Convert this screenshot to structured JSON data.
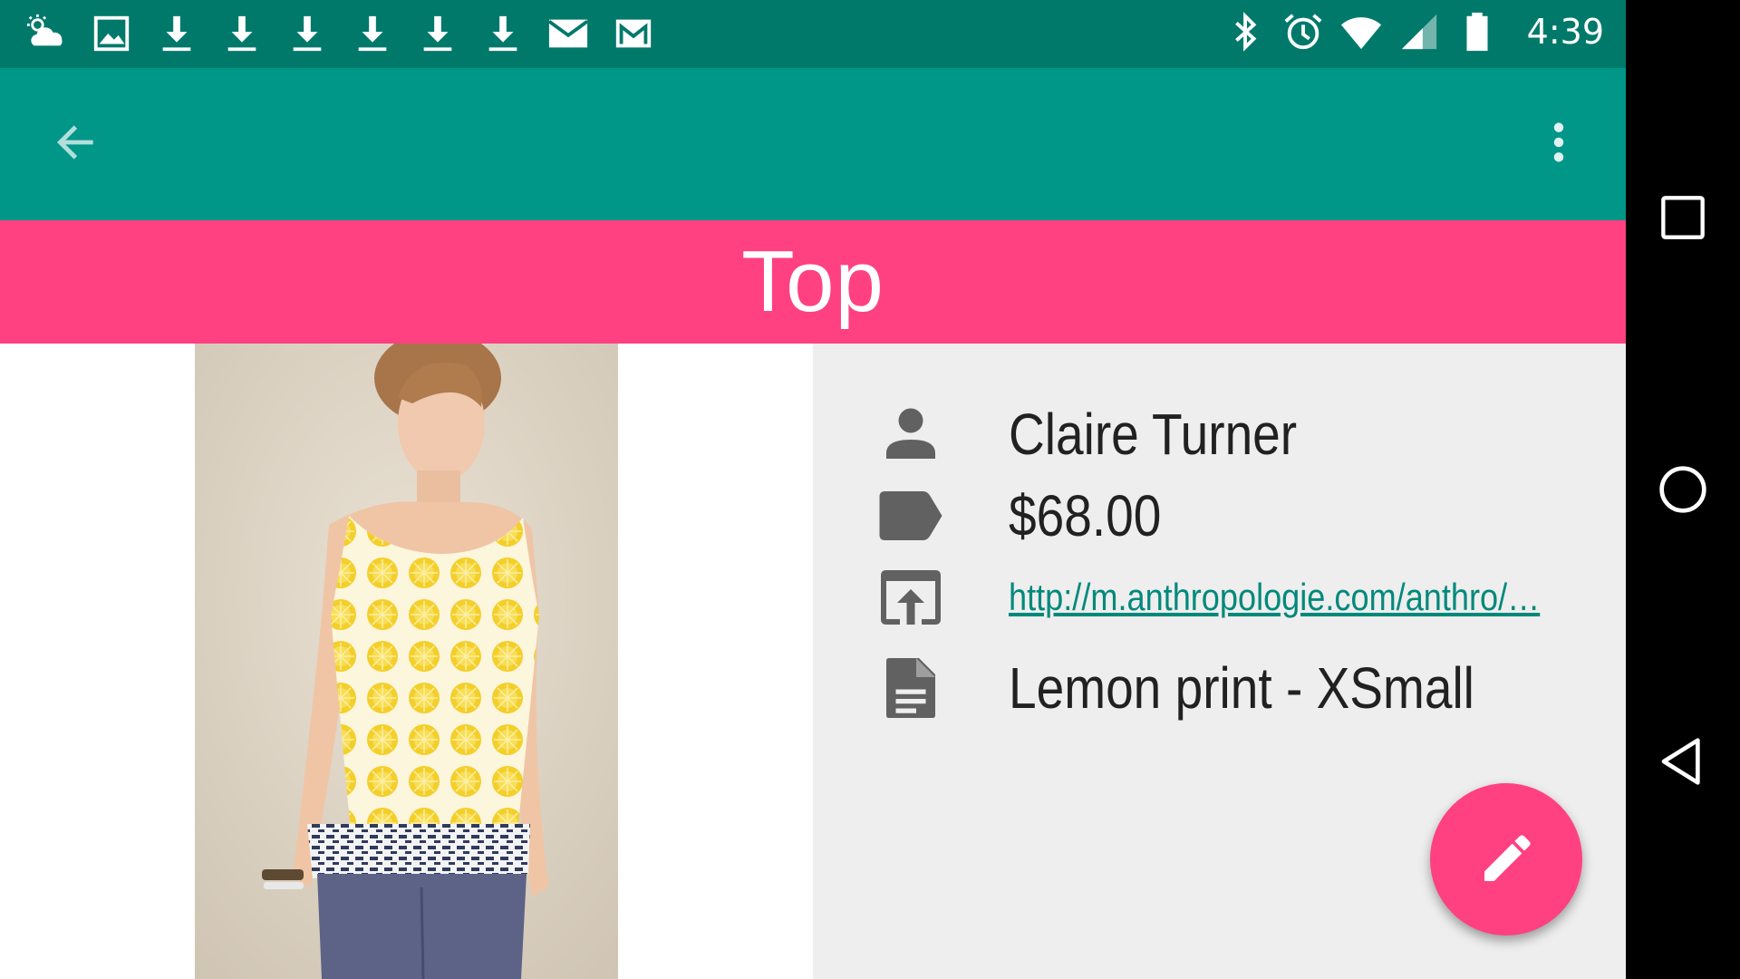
{
  "status_bar": {
    "time": "4:39",
    "left_icons": [
      "weather-icon",
      "image-icon",
      "download-icon",
      "download-icon",
      "download-icon",
      "download-icon",
      "download-icon",
      "download-icon",
      "email-icon",
      "gmail-icon"
    ],
    "right_icons": [
      "bluetooth-icon",
      "alarm-icon",
      "wifi-icon",
      "cell-signal-icon",
      "battery-icon"
    ],
    "color": "#00796b"
  },
  "toolbar": {
    "back_icon": "arrow-back-icon",
    "menu_icon": "more-vert-icon",
    "color": "#009688"
  },
  "category": {
    "title": "Top",
    "color": "#ff4081"
  },
  "item": {
    "image": "product-photo",
    "fields": [
      {
        "icon": "person-icon",
        "value": "Claire Turner"
      },
      {
        "icon": "label-icon",
        "value": "$68.00"
      },
      {
        "icon": "open-in-browser-icon",
        "value": "http://m.anthropologie.com/anthro/…"
      },
      {
        "icon": "note-icon",
        "value": "Lemon print - XSmall"
      }
    ]
  },
  "fab": {
    "icon": "edit-icon",
    "color": "#ff4081"
  },
  "nav_bar": {
    "buttons": [
      "recents-icon",
      "home-icon",
      "back-icon"
    ]
  }
}
